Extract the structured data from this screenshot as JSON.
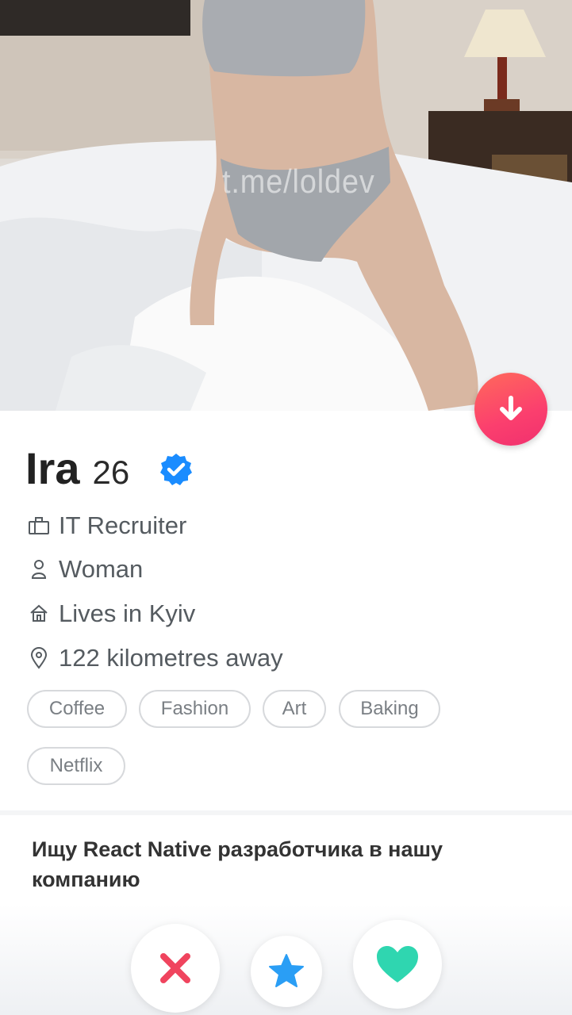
{
  "profile": {
    "name": "Ira",
    "age": "26",
    "job": "IT Recruiter",
    "gender": "Woman",
    "location": "Lives in Kyiv",
    "distance": "122 kilometres away",
    "interests": [
      "Coffee",
      "Fashion",
      "Art",
      "Baking",
      "Netflix"
    ],
    "bio": "Ищу React Native разработчика в нашу компанию"
  },
  "photo": {
    "watermark": "t.me/loldev"
  },
  "icons": {
    "collapse": "arrow-down-icon",
    "verified": "verified-badge-icon",
    "job": "briefcase-icon",
    "gender": "person-icon",
    "location": "home-icon",
    "distance": "location-pin-icon",
    "nope": "close-icon",
    "super_like": "star-icon",
    "like": "heart-icon"
  },
  "colors": {
    "accent": "#fb3f6e",
    "verified": "#1a8cff",
    "nope": "#f0445e",
    "super_like": "#2a9ef5",
    "like": "#2fd6b0"
  }
}
